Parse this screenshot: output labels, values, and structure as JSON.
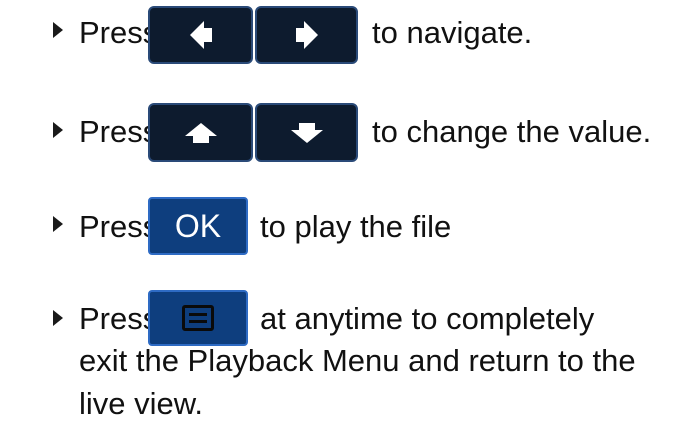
{
  "instructions": [
    {
      "prefix": "Press",
      "keys": [
        {
          "label": "",
          "icon": "arrow-left-icon"
        },
        {
          "label": "",
          "icon": "arrow-right-icon"
        }
      ],
      "suffix": "to navigate."
    },
    {
      "prefix": "Press",
      "keys": [
        {
          "label": "",
          "icon": "arrow-up-icon"
        },
        {
          "label": "",
          "icon": "arrow-down-icon"
        }
      ],
      "suffix": "to change the value."
    },
    {
      "prefix": "Press",
      "keys": [
        {
          "label": "OK",
          "icon": ""
        }
      ],
      "suffix": "to play the file"
    },
    {
      "prefix": "Press",
      "keys": [
        {
          "label": "",
          "icon": "menu-icon"
        }
      ],
      "suffix": "at anytime to completely",
      "continuation": [
        "exit the Playback Menu and return to the",
        "live view."
      ]
    }
  ],
  "colors": {
    "key_dark": "#0d1b2e",
    "key_border": "#2a4a78",
    "key_blue": "#0e3e7e",
    "text": "#111111"
  }
}
